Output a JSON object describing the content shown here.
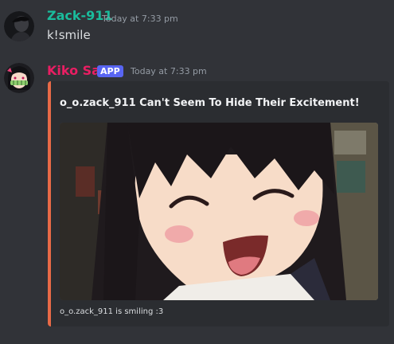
{
  "messages": [
    {
      "username": "Zack-911",
      "timestamp": "Today at 7:33 pm",
      "content": "k!smile",
      "username_color": "#1abc9c"
    },
    {
      "username": "Kiko San",
      "badge": "APP",
      "timestamp": "Today at 7:33 pm",
      "username_color": "#e91e63",
      "badge_color": "#5865f2",
      "embed": {
        "title": "o_o.zack_911 Can't Seem To Hide Their Excitement!",
        "footer": "o_o.zack_911 is smiling :3",
        "accent_color": "#e86a47",
        "image_icon": "anime-girl-smiling-gif"
      }
    }
  ]
}
